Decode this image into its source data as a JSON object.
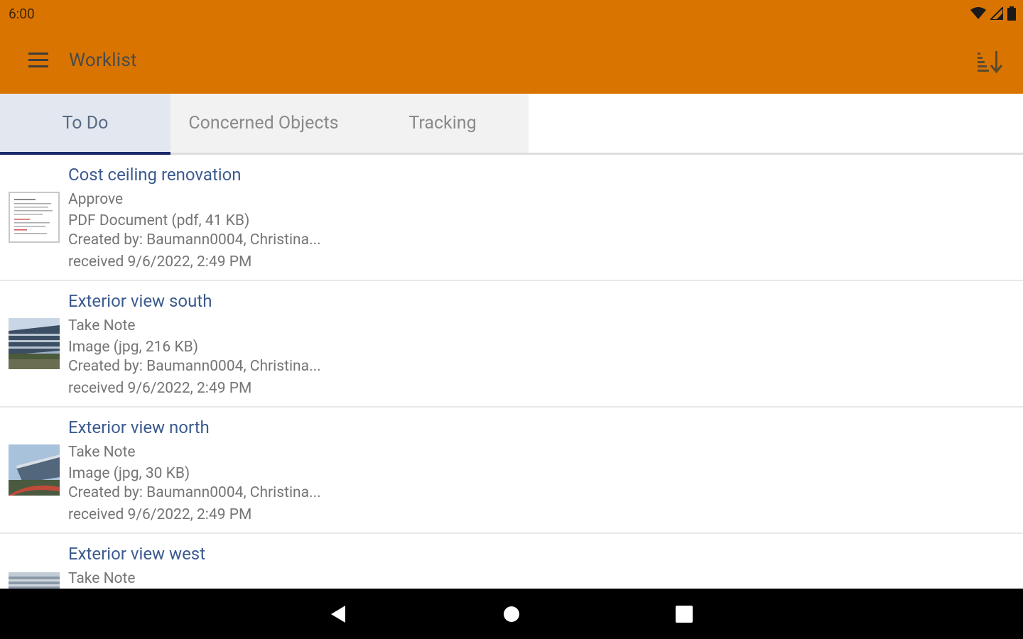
{
  "status_bar": {
    "time": "6:00"
  },
  "app_bar": {
    "title": "Worklist"
  },
  "tabs": [
    {
      "label": "To Do",
      "active": true
    },
    {
      "label": "Concerned Objects",
      "active": false
    },
    {
      "label": "Tracking",
      "active": false
    }
  ],
  "items": [
    {
      "title": "Cost ceiling renovation",
      "action": "Approve",
      "file": "PDF Document (pdf, 41 KB)",
      "creator": "Created by: Baumann0004, Christina...",
      "received": "received 9/6/2022, 2:49 PM",
      "thumbnail": "pdf-document-thumbnail"
    },
    {
      "title": "Exterior view  south",
      "action": "Take Note",
      "file": "Image (jpg, 216 KB)",
      "creator": "Created by: Baumann0004, Christina...",
      "received": "received 9/6/2022, 2:49 PM",
      "thumbnail": "building-photo-thumbnail"
    },
    {
      "title": "Exterior view north",
      "action": "Take Note",
      "file": "Image (jpg, 30 KB)",
      "creator": "Created by: Baumann0004, Christina...",
      "received": "received 9/6/2022, 2:49 PM",
      "thumbnail": "building-photo-thumbnail"
    },
    {
      "title": "Exterior view west",
      "action": "Take Note",
      "thumbnail": "building-photo-thumbnail"
    }
  ],
  "colors": {
    "app_bar": "#d97400",
    "tab_indicator": "#1a2a6c",
    "item_title": "#3b5a8f",
    "secondary_text": "#757575"
  }
}
